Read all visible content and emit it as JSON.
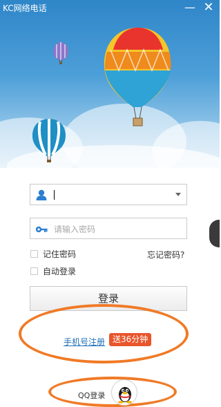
{
  "window": {
    "title": "KC网络电话",
    "minimize_label": "—",
    "close_label": "✕"
  },
  "login": {
    "username_value": "|",
    "password_placeholder": "请输入密码",
    "remember_password_label": "记住密码",
    "auto_login_label": "自动登录",
    "forgot_password_label": "忘记密码?",
    "login_button_label": "登录"
  },
  "register": {
    "link_label": "手机号注册",
    "promo_label": "送36分钟"
  },
  "qq": {
    "login_label": "QQ登录"
  },
  "colors": {
    "accent_orange": "#f07a26",
    "link_blue": "#1f6fb8",
    "promo_red": "#e8552c",
    "sky_blue": "#2f86c8"
  },
  "icons": [
    "user-icon",
    "key-icon",
    "dropdown-icon",
    "qq-penguin-icon",
    "balloon-illustration"
  ]
}
